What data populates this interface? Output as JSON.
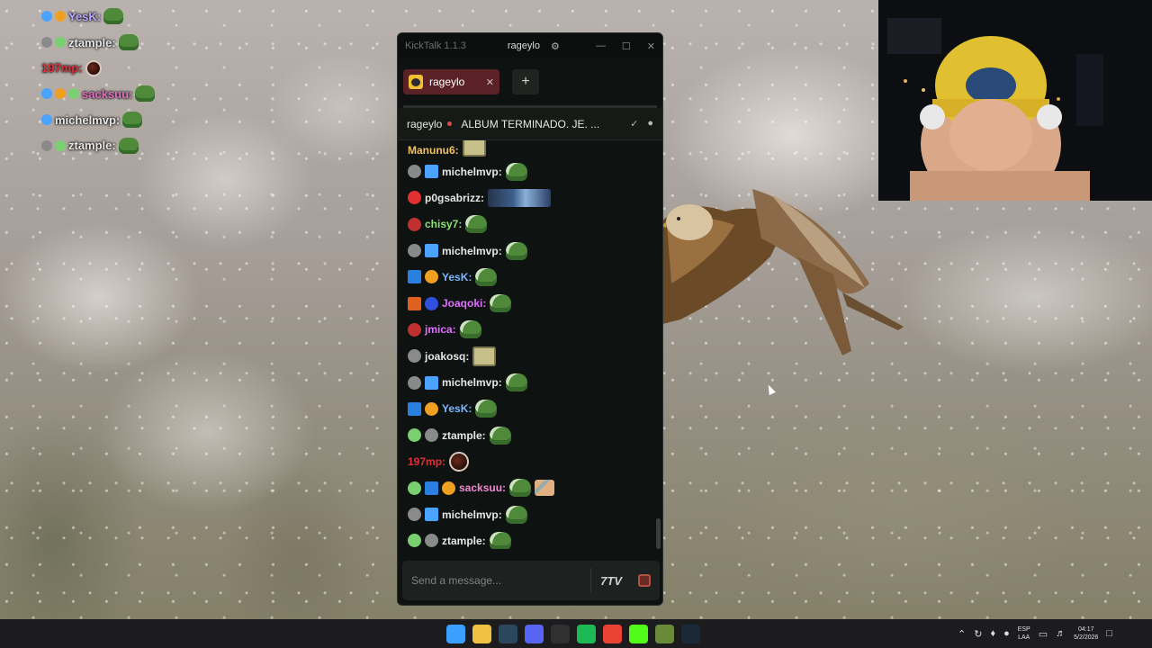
{
  "overlay_chat": [
    {
      "username": "YesK:",
      "color": "#b8a8ff",
      "badges": [
        "#4aa3ff",
        "#f0a020"
      ],
      "emote": "pepe"
    },
    {
      "username": "ztample:",
      "color": "#e6e6e6",
      "badges": [
        "#8a8a8a",
        "#7ad070"
      ],
      "emote": "pepe"
    },
    {
      "username": "197mp:",
      "color": "#e0303a",
      "badges": [],
      "emote": "ball"
    },
    {
      "username": "sacksuu:",
      "color": "#e070c0",
      "badges": [
        "#4aa3ff",
        "#f0a020",
        "#7ad070"
      ],
      "emote": "pepe"
    },
    {
      "username": "michelmvp:",
      "color": "#e6e6e6",
      "badges": [
        "#4aa3ff"
      ],
      "emote": "pepe"
    },
    {
      "username": "ztample:",
      "color": "#e6e6e6",
      "badges": [
        "#8a8a8a",
        "#7ad070"
      ],
      "emote": "pepe"
    }
  ],
  "kicktalk": {
    "app_name": "KickTalk 1.1.3",
    "titlebar_user": "rageylo",
    "tab": {
      "label": "rageylo"
    },
    "channel": {
      "name": "rageylo",
      "stream_title": "ALBUM TERMINADO. JE. ..."
    },
    "input": {
      "placeholder": "Send a message..."
    },
    "emote_button": "7TV",
    "messages": [
      {
        "username": "Manunu6:",
        "color": "#f0c060",
        "badges": [],
        "emote": "face",
        "partial": true
      },
      {
        "username": "michelmvp:",
        "color": "#e6e6e6",
        "badges": [
          "#8a8a8a",
          "#4aa3ff"
        ],
        "emote": "pepe"
      },
      {
        "username": "p0gsabrizz:",
        "color": "#e6e6e6",
        "badges": [
          "#e03030"
        ],
        "emote": "wide"
      },
      {
        "username": "chisy7:",
        "color": "#8ee07a",
        "badges": [
          "#c03030"
        ],
        "emote": "pepe"
      },
      {
        "username": "michelmvp:",
        "color": "#e6e6e6",
        "badges": [
          "#8a8a8a",
          "#4aa3ff"
        ],
        "emote": "pepe"
      },
      {
        "username": "YesK:",
        "color": "#7ab8ff",
        "badges": [
          "#2a80e0",
          "#f0a020"
        ],
        "emote": "pepe"
      },
      {
        "username": "Joaqoki:",
        "color": "#e070ff",
        "badges": [
          "#e06020",
          "#3050e0"
        ],
        "emote": "pepe"
      },
      {
        "username": "jmica:",
        "color": "#e070ff",
        "badges": [
          "#c03030"
        ],
        "emote": "pepe"
      },
      {
        "username": "joakosq:",
        "color": "#e6e6e6",
        "badges": [
          "#8a8a8a"
        ],
        "emote": "face"
      },
      {
        "username": "michelmvp:",
        "color": "#e6e6e6",
        "badges": [
          "#8a8a8a",
          "#4aa3ff"
        ],
        "emote": "pepe"
      },
      {
        "username": "YesK:",
        "color": "#7ab8ff",
        "badges": [
          "#2a80e0",
          "#f0a020"
        ],
        "emote": "pepe"
      },
      {
        "username": "ztample:",
        "color": "#e6e6e6",
        "badges": [
          "#7ad070",
          "#8a8a8a"
        ],
        "emote": "pepe"
      },
      {
        "username": "197mp:",
        "color": "#e0303a",
        "badges": [],
        "emote": "ball"
      },
      {
        "username": "sacksuu:",
        "color": "#f08ad0",
        "badges": [
          "#7ad070",
          "#2a80e0",
          "#f0a020"
        ],
        "emote": "pepe",
        "extra": "small"
      },
      {
        "username": "michelmvp:",
        "color": "#e6e6e6",
        "badges": [
          "#8a8a8a",
          "#4aa3ff"
        ],
        "emote": "pepe"
      },
      {
        "username": "ztample:",
        "color": "#e6e6e6",
        "badges": [
          "#7ad070",
          "#8a8a8a"
        ],
        "emote": "pepe"
      }
    ]
  },
  "taskbar": {
    "apps": [
      {
        "name": "windows-start-icon",
        "color": "#3aa0ff"
      },
      {
        "name": "file-explorer-icon",
        "color": "#f0c040"
      },
      {
        "name": "steam-icon",
        "color": "#2a475e"
      },
      {
        "name": "discord-icon",
        "color": "#5865f2"
      },
      {
        "name": "obs-icon",
        "color": "#303030"
      },
      {
        "name": "spotify-icon",
        "color": "#1db954"
      },
      {
        "name": "chrome-icon",
        "color": "#ea4335"
      },
      {
        "name": "kick-icon",
        "color": "#53fc18"
      },
      {
        "name": "game-launcher-icon",
        "color": "#6a8a3a"
      },
      {
        "name": "steam-icon-2",
        "color": "#1b2838"
      }
    ],
    "lang_top": "ESP",
    "lang_bottom": "LAA",
    "time": "04:17",
    "date": "5/2/2026"
  }
}
